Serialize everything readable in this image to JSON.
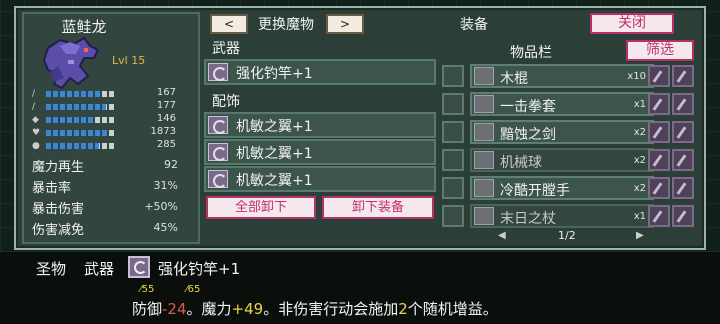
{
  "monster": {
    "name": "蓝鲑龙",
    "level": "Lvl 15",
    "stats": [
      {
        "icon": "sword-icon",
        "value": "167",
        "fill": 0.8
      },
      {
        "icon": "staff-icon",
        "value": "177",
        "fill": 0.85
      },
      {
        "icon": "shield-icon",
        "value": "146",
        "fill": 0.7
      },
      {
        "icon": "heart-icon",
        "value": "1873",
        "fill": 0.9
      },
      {
        "icon": "mana-icon",
        "value": "285",
        "fill": 0.75
      }
    ],
    "attributes": [
      {
        "label": "魔力再生",
        "value": "92"
      },
      {
        "label": "暴击率",
        "value": "31%"
      },
      {
        "label": "暴击伤害",
        "value": "+50%"
      },
      {
        "label": "伤害减免",
        "value": "45%"
      }
    ]
  },
  "header": {
    "prev": "<",
    "switch_label": "更换魔物",
    "next": ">",
    "title": "装备",
    "close_label": "关闭"
  },
  "equipment": {
    "weapon_label": "武器",
    "weapon": "强化钓竿+1",
    "accessory_label": "配饰",
    "accessories": [
      "机敏之翼+1",
      "机敏之翼+1",
      "机敏之翼+1"
    ],
    "unequip_all": "全部卸下",
    "unequip": "卸下装备"
  },
  "inventory": {
    "title": "物品栏",
    "filter_label": "筛选",
    "items": [
      {
        "name": "木棍",
        "qty": "x10",
        "dim": false
      },
      {
        "name": "一击拳套",
        "qty": "x1",
        "dim": false
      },
      {
        "name": "黯蚀之剑",
        "qty": "x2",
        "dim": false
      },
      {
        "name": "机械球",
        "qty": "x2",
        "dim": true
      },
      {
        "name": "冷酷开膛手",
        "qty": "x2",
        "dim": false
      },
      {
        "name": "末日之杖",
        "qty": "x1",
        "dim": true
      }
    ],
    "page": "1/2"
  },
  "tooltip": {
    "category": "圣物",
    "slot": "武器",
    "item": "强化钓竿+1",
    "stat_a": "55",
    "stat_b": "65",
    "desc_prefix": "防御",
    "desc_def": "-24",
    "desc_mid": "。魔力",
    "desc_mana": "+49",
    "desc_mid2": "。非伤害行动会施加",
    "desc_count": "2",
    "desc_suffix": "个随机增益。"
  },
  "colors": {
    "panel": "#2b3f38",
    "accent_pink": "#c03070",
    "bar_blue": "#3b86d9",
    "highlight_yellow": "#f1d34a",
    "negative_red": "#e05454"
  }
}
